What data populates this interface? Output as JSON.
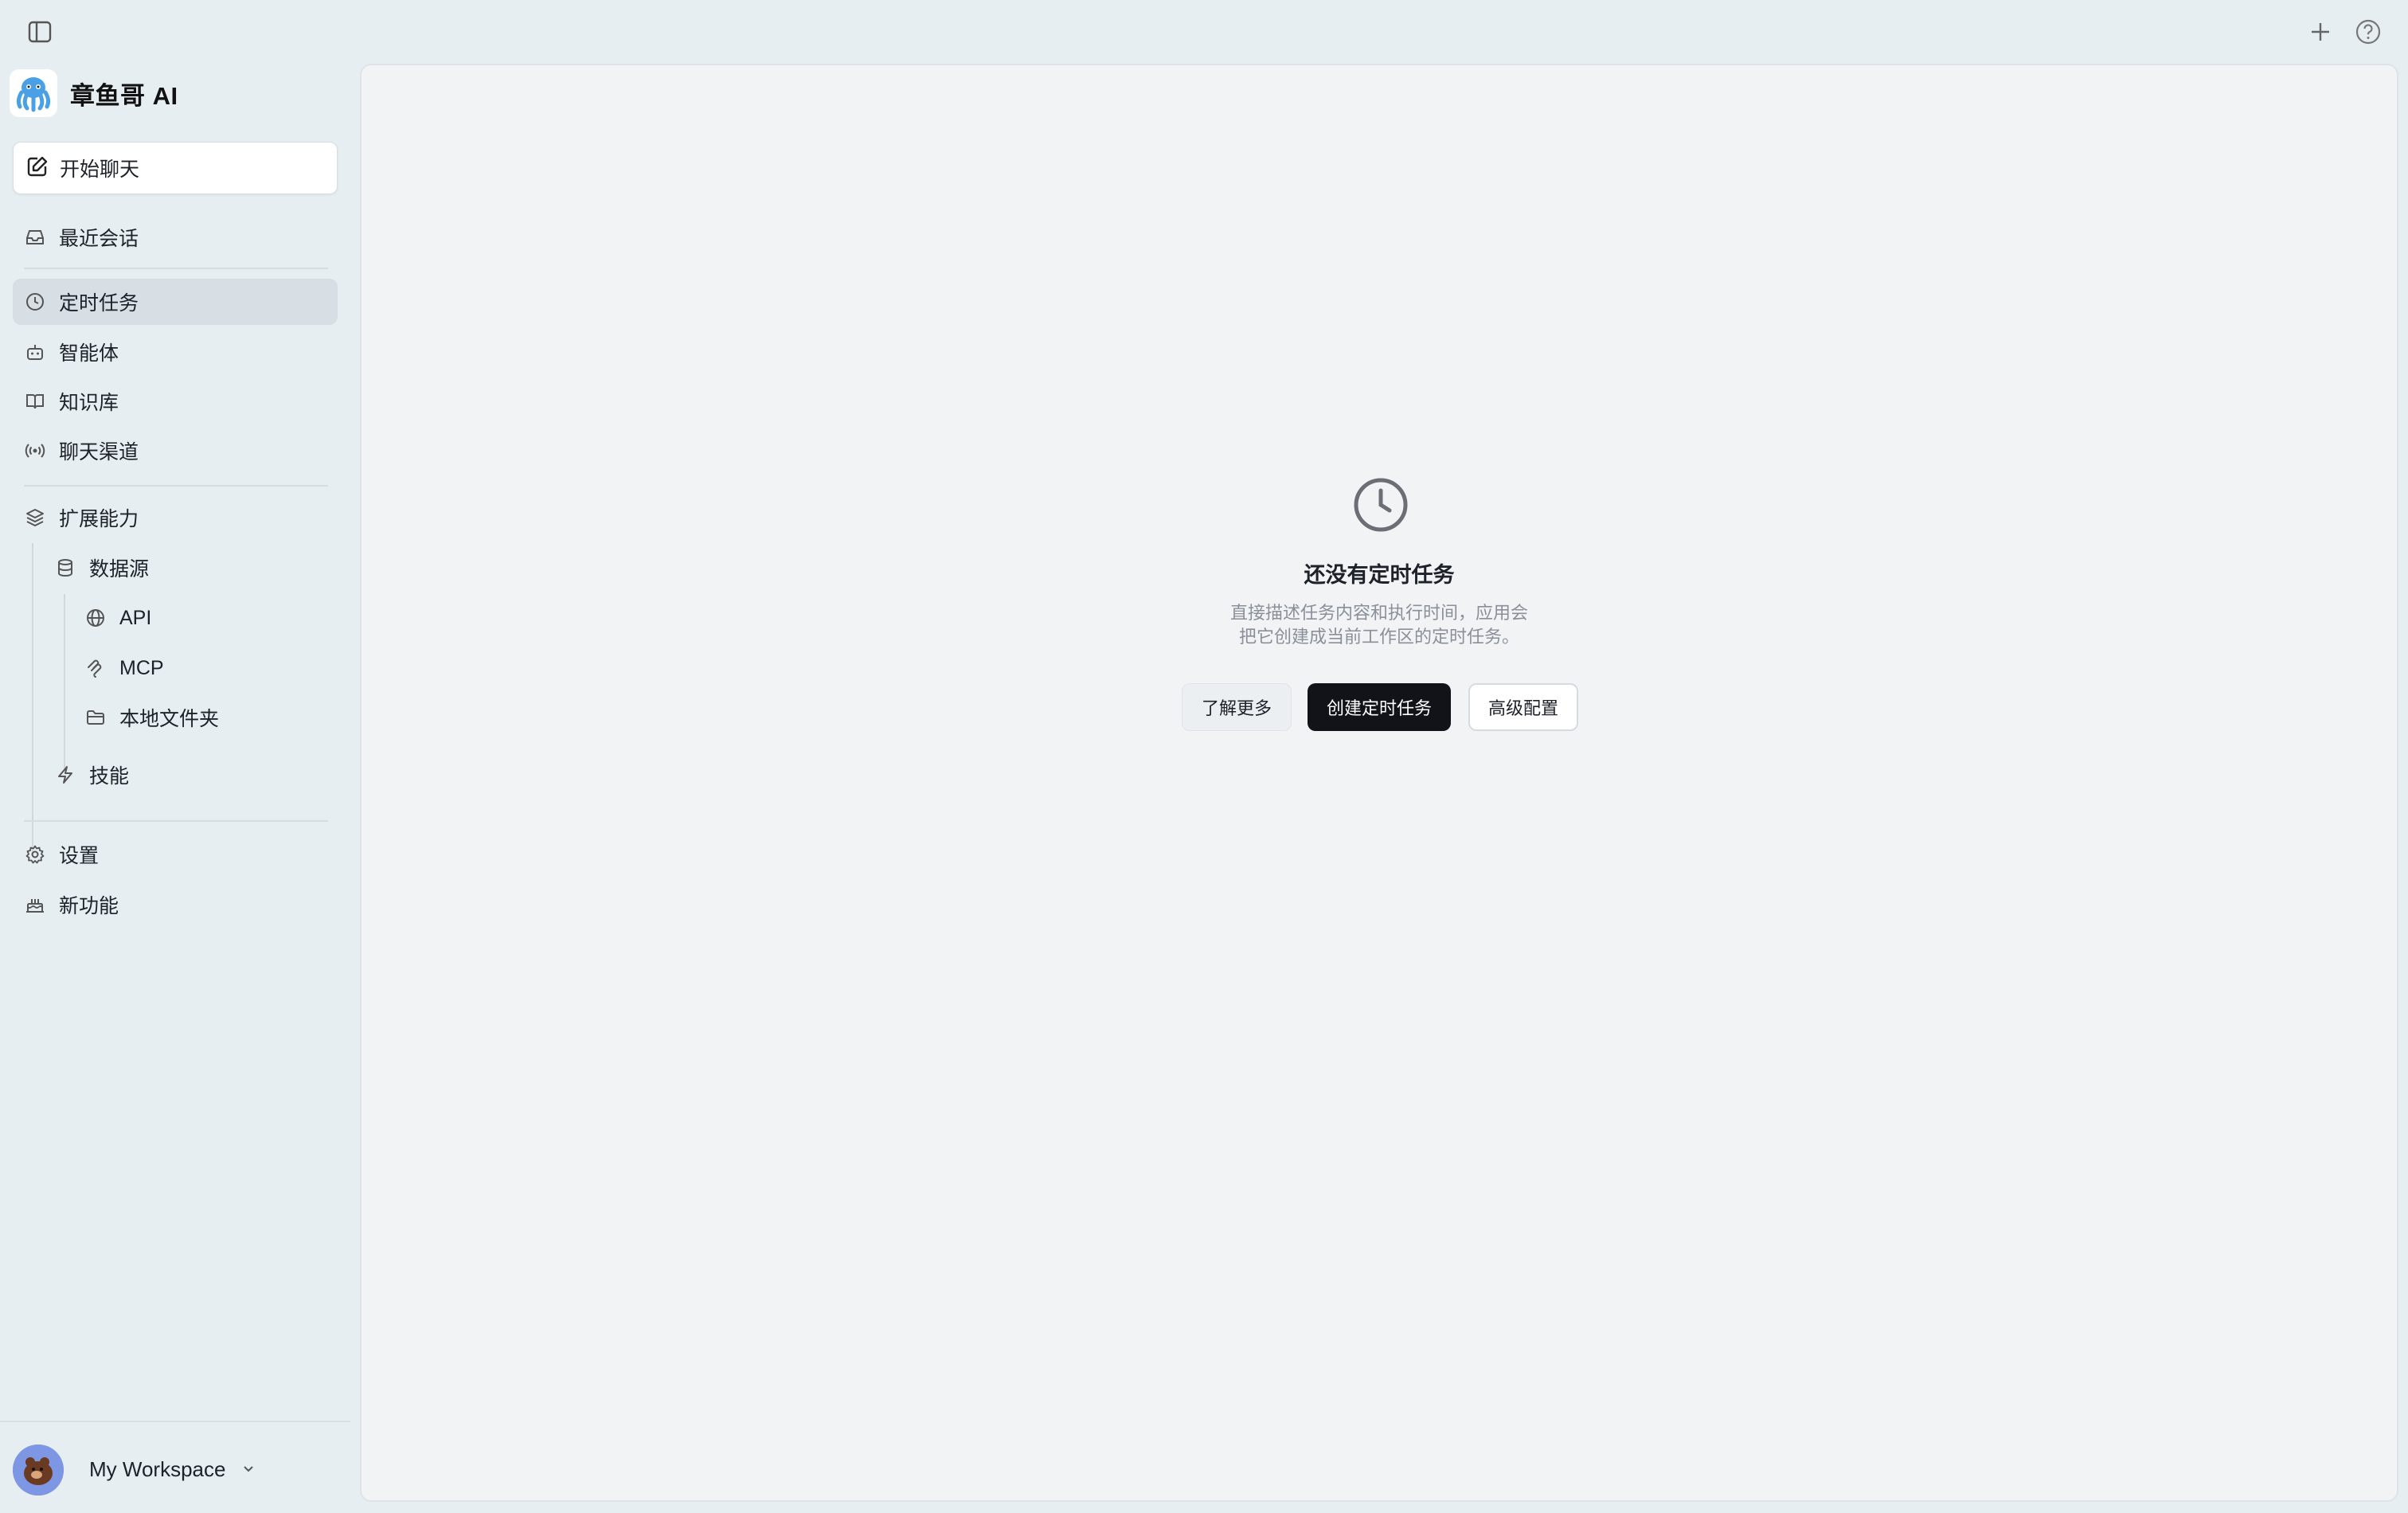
{
  "app": {
    "brand_name": "章鱼哥 AI"
  },
  "topbar": {
    "sidebar_toggle_icon": "sidebar-toggle-icon",
    "new_icon": "plus-icon",
    "help_icon": "help-icon"
  },
  "sidebar": {
    "start_chat": "开始聊天",
    "items": [
      {
        "label": "最近会话",
        "icon": "inbox-icon"
      },
      {
        "label": "定时任务",
        "icon": "clock-icon",
        "active": true
      },
      {
        "label": "智能体",
        "icon": "robot-icon"
      },
      {
        "label": "知识库",
        "icon": "book-icon"
      },
      {
        "label": "聊天渠道",
        "icon": "broadcast-icon"
      },
      {
        "label": "扩展能力",
        "icon": "layers-icon"
      },
      {
        "label": "数据源",
        "icon": "database-icon"
      },
      {
        "label": "API",
        "icon": "globe-icon"
      },
      {
        "label": "MCP",
        "icon": "mcp-icon"
      },
      {
        "label": "本地文件夹",
        "icon": "folder-icon"
      },
      {
        "label": "技能",
        "icon": "lightning-icon"
      },
      {
        "label": "设置",
        "icon": "gear-icon"
      },
      {
        "label": "新功能",
        "icon": "cake-icon"
      }
    ],
    "workspace": {
      "name": "My Workspace"
    }
  },
  "main": {
    "empty_state": {
      "icon": "clock-icon",
      "title": "还没有定时任务",
      "desc_line1": "直接描述任务内容和执行时间，应用会",
      "desc_line2": "把它创建成当前工作区的定时任务。"
    },
    "buttons": {
      "learn_more": "了解更多",
      "create": "创建定时任务",
      "advanced": "高级配置"
    }
  },
  "colors": {
    "primary_button": "#111318",
    "active_nav": "#d8dfe4",
    "background": "#e7eef2"
  }
}
